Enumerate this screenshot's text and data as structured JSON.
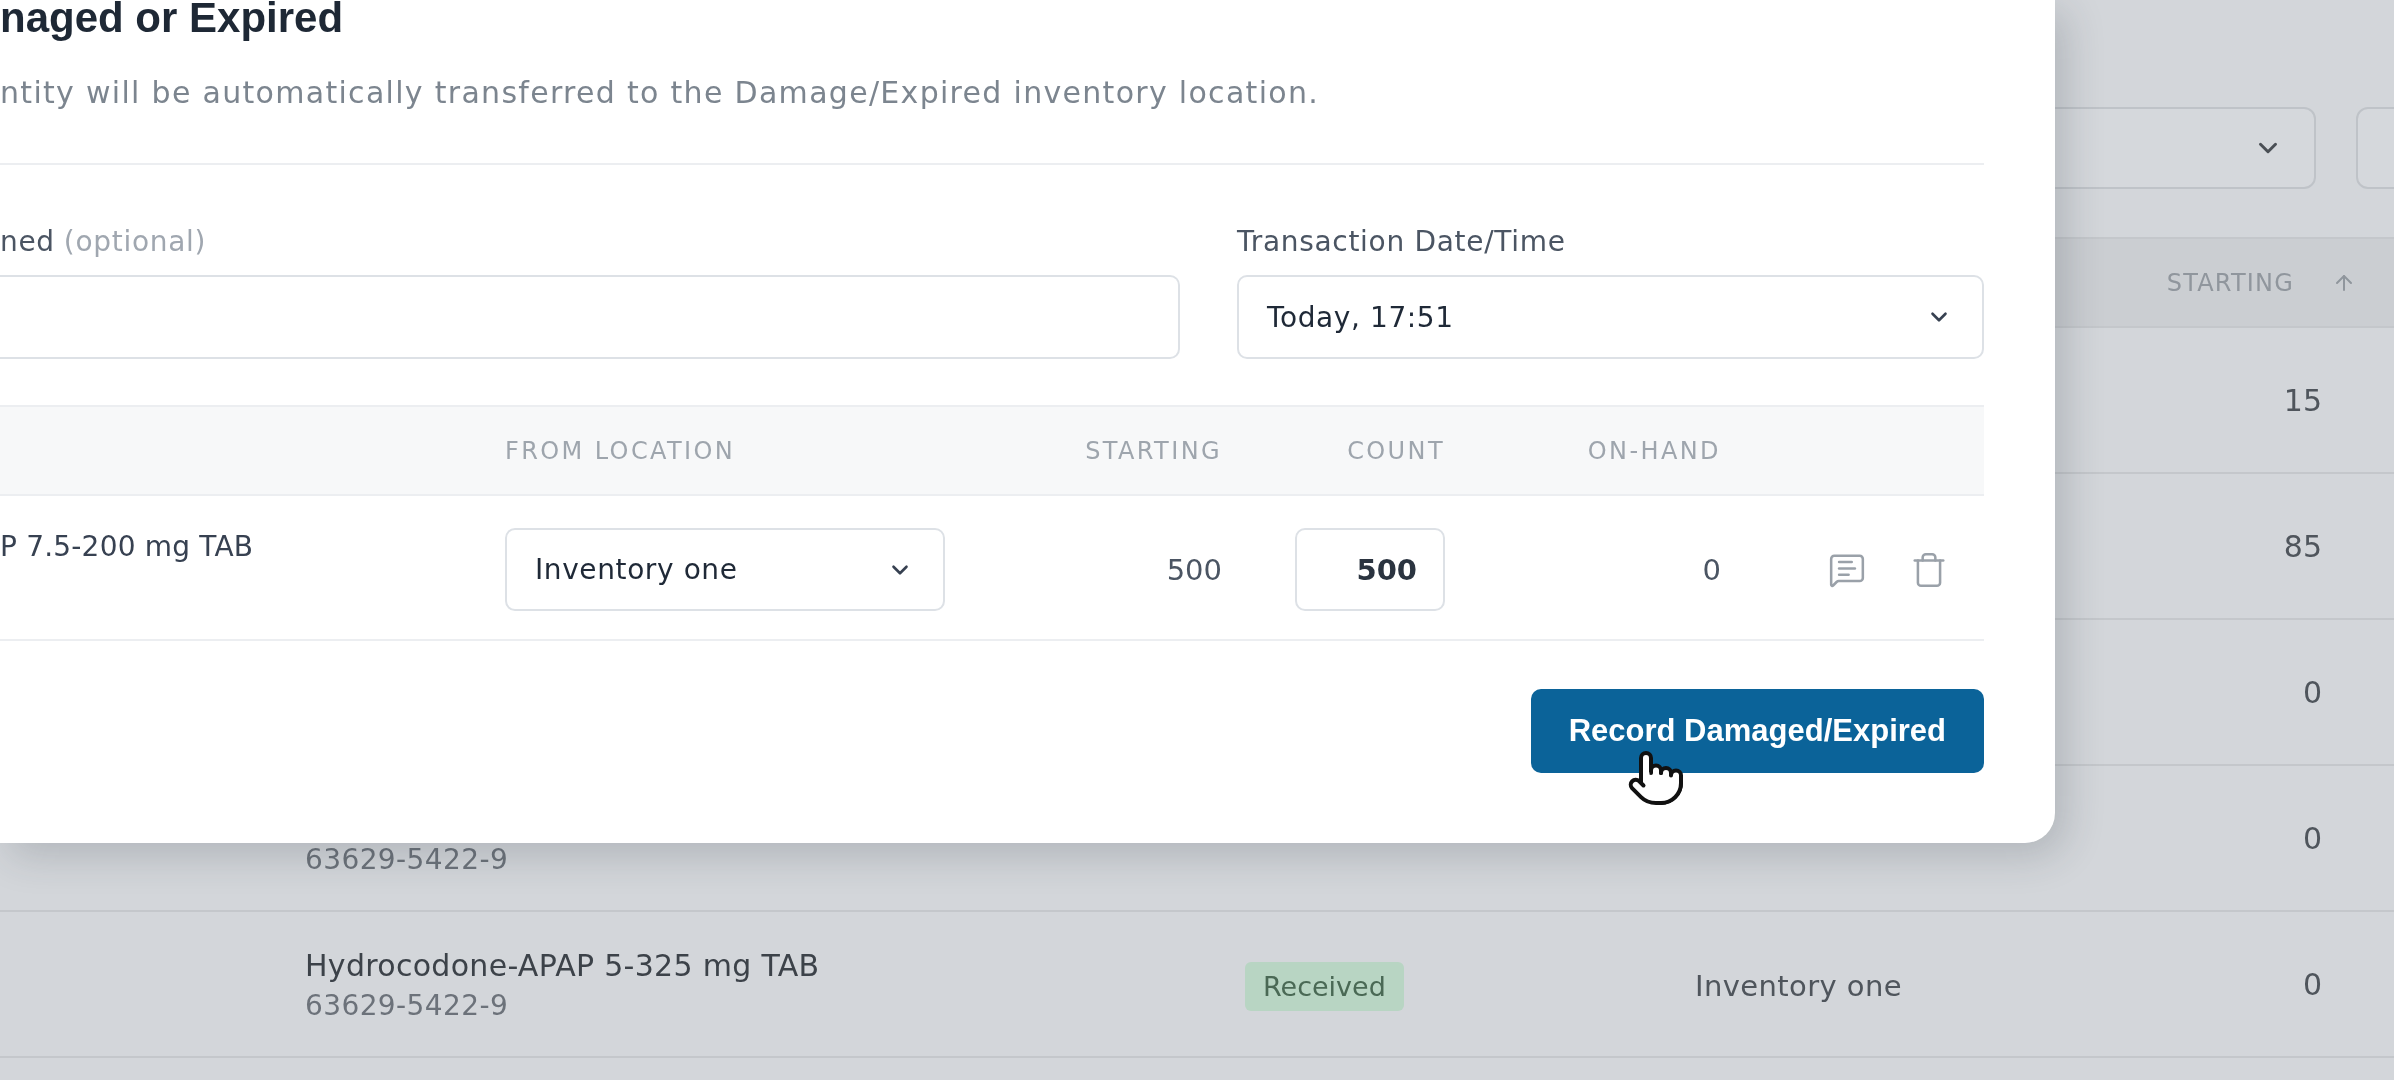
{
  "modal": {
    "title": "naged or Expired",
    "description": "ntity will be automatically transferred to the Damage/Expired inventory location.",
    "fields": [
      {
        "kind": "text",
        "label": "ned",
        "hint": "(optional)"
      },
      {
        "kind": "select",
        "label": "Transaction Date/Time",
        "value": "Today, 17:51"
      }
    ],
    "table": {
      "columns": [
        {
          "label": "FROM LOCATION"
        },
        {
          "label": "STARTING"
        },
        {
          "label": "COUNT"
        },
        {
          "label": "ON-HAND"
        }
      ],
      "rows": [
        {
          "item": "P 7.5-200 mg TAB",
          "from_location": "Inventory one",
          "starting": "500",
          "count": "500",
          "on_hand": "0"
        }
      ]
    },
    "submit_button": "Record Damaged/Expired"
  },
  "background_table": {
    "columns": [
      {
        "label": "STARTING",
        "sorted_ascending": true
      }
    ],
    "rows": [
      {
        "starting": "15"
      },
      {
        "starting": "85"
      },
      {
        "starting": "0"
      },
      {
        "product_code": "63629-5422-9",
        "starting": "0"
      },
      {
        "product_name": "Hydrocodone-APAP 5-325 mg TAB",
        "product_code": "63629-5422-9",
        "status": "Received",
        "location": "Inventory one",
        "starting": "0"
      }
    ]
  }
}
